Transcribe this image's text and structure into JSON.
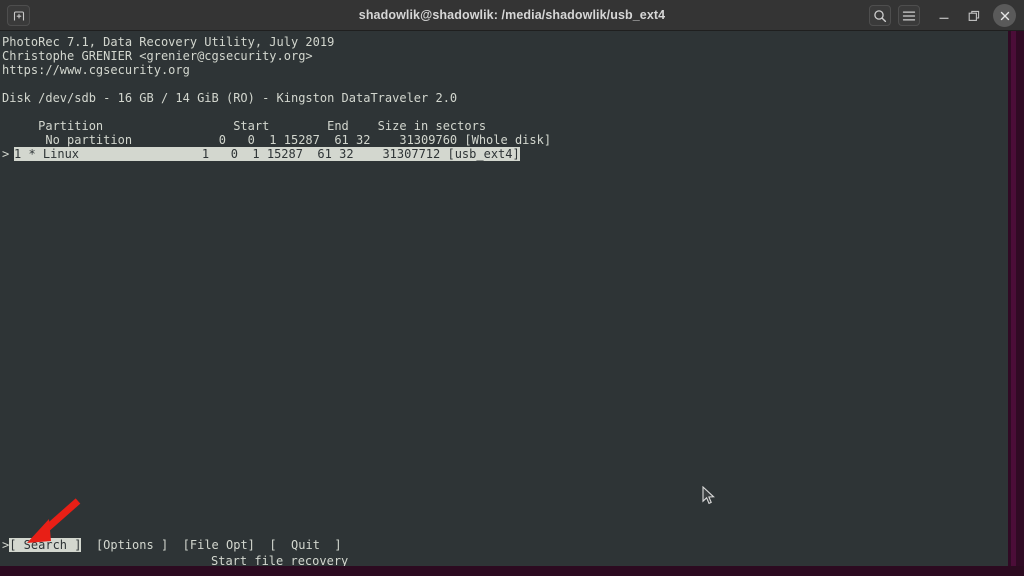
{
  "window": {
    "title": "shadowlik@shadowlik: /media/shadowlik/usb_ext4",
    "new_tab_label": "New Tab",
    "search_label": "Search",
    "menu_label": "Menu",
    "minimize_label": "Minimize",
    "maximize_label": "Maximize",
    "close_label": "Close",
    "titlebar_color": "#343434",
    "terminal_bg_color": "#2e3436",
    "terminal_fg_color": "#d3d7cf",
    "window_edge_color": "#300a24"
  },
  "terminal": {
    "header_lines": [
      "PhotoRec 7.1, Data Recovery Utility, July 2019",
      "Christophe GRENIER <grenier@cgsecurity.org>",
      "https://www.cgsecurity.org"
    ],
    "disk_line": "Disk /dev/sdb - 16 GB / 14 GiB (RO) - Kingston DataTraveler 2.0",
    "table": {
      "header": "     Partition                  Start        End    Size in sectors",
      "columns": [
        "Partition",
        "Start",
        "End",
        "Size in sectors"
      ],
      "rows": [
        {
          "selected": false,
          "prefix": "  ",
          "text": "      No partition            0   0  1 15287  61 32    31309760 [Whole disk]",
          "name": "No partition",
          "start": "0   0  1",
          "end": "15287  61 32",
          "size_in_sectors": "31309760",
          "label": "[Whole disk]"
        },
        {
          "selected": true,
          "prefix": "> ",
          "text": "1 * Linux                 1   0  1 15287  61 32    31307712 [usb_ext4]",
          "name": "1 * Linux",
          "start": "1   0  1",
          "end": "15287  61 32",
          "size_in_sectors": "31307712",
          "label": "[usb_ext4]"
        }
      ]
    },
    "menu": {
      "prefix": ">",
      "items": [
        {
          "label": "[ Search ]",
          "selected": true
        },
        {
          "label": "[Options ]",
          "selected": false
        },
        {
          "label": "[File Opt]",
          "selected": false
        },
        {
          "label": "[  Quit  ]",
          "selected": false
        }
      ],
      "hint": "Start file recovery"
    }
  },
  "annotation": {
    "arrow_color": "#e81f16",
    "arrow_name": "red-arrow-pointing-to-search"
  }
}
